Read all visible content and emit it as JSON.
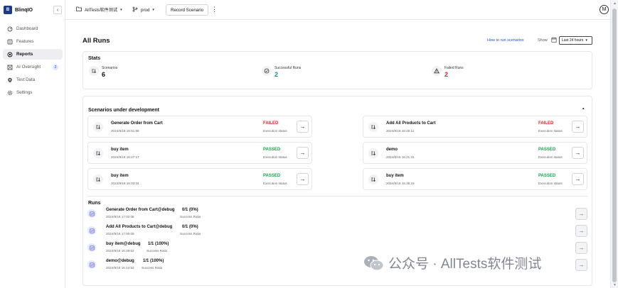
{
  "app": {
    "name": "BlinqIO",
    "logo_text": "B"
  },
  "sidebar": {
    "collapse_glyph": "‹",
    "items": [
      {
        "label": "Dashboard",
        "icon": "dashboard-icon",
        "active": false
      },
      {
        "label": "Features",
        "icon": "features-icon",
        "active": false
      },
      {
        "label": "Reports",
        "icon": "reports-icon",
        "active": true
      },
      {
        "label": "AI Oversight",
        "icon": "ai-oversight-icon",
        "active": false,
        "badge": "2"
      },
      {
        "label": "Test Data",
        "icon": "test-data-icon",
        "active": false
      },
      {
        "label": "Settings",
        "icon": "gear-icon",
        "active": false
      }
    ]
  },
  "topbar": {
    "project": "AllTests软件测试",
    "environment": "prod",
    "record_button": "Record Scenario",
    "more_glyph": "⋮",
    "avatar_initial": "M"
  },
  "page": {
    "title": "All Runs",
    "howto_link": "How to run scenarios",
    "show_label": "Show",
    "range_value": "Last 24 hours"
  },
  "stats": {
    "title": "Stats",
    "items": [
      {
        "label": "Scenarios",
        "value": "6",
        "color": "#111111"
      },
      {
        "label": "Successful Runs",
        "value": "2",
        "color": "#0d9488"
      },
      {
        "label": "Failed Runs",
        "value": "2",
        "color": "#dc2626"
      }
    ]
  },
  "scenarios": {
    "title": "Scenarios under development",
    "collapse_glyph": "▴",
    "items": [
      {
        "name": "Generate Order from Cart",
        "date": "2024/8/18 16:51:58",
        "status": "FAILED",
        "status_sub": "Execution status"
      },
      {
        "name": "Add All Products to Cart",
        "date": "2024/8/18 16:45:11",
        "status": "FAILED",
        "status_sub": "Execution status"
      },
      {
        "name": "buy item",
        "date": "2024/8/18 16:27:17",
        "status": "PASSED",
        "status_sub": "Execution status"
      },
      {
        "name": "demo",
        "date": "2024/8/18 16:21:31",
        "status": "PASSED",
        "status_sub": "Execution status"
      },
      {
        "name": "buy item",
        "date": "2024/8/18 16:03:34",
        "status": "PASSED",
        "status_sub": "Execution status"
      },
      {
        "name": "buy item",
        "date": "2024/8/18 15:35:15",
        "status": "PASSED",
        "status_sub": "Execution status"
      }
    ]
  },
  "runs": {
    "title": "Runs",
    "items": [
      {
        "name": "Generate Order from Cart@debug",
        "date": "2024/8/18 17:02:06",
        "ratio": "0/1 (0%)",
        "ratio_sub": "Success Ratio"
      },
      {
        "name": "Add All Products to Cart@debug",
        "date": "2024/8/18 17:00:09",
        "ratio": "0/1 (0%)",
        "ratio_sub": "Success Ratio"
      },
      {
        "name": "buy item@debug",
        "date": "2024/8/18 16:29:02",
        "ratio": "1/1 (100%)",
        "ratio_sub": "Success Ratio"
      },
      {
        "name": "demo@debug",
        "date": "2024/8/18 16:14:52",
        "ratio": "1/1 (100%)",
        "ratio_sub": "Success Ratio"
      }
    ]
  },
  "watermark": {
    "text": "公众号 · AllTests软件测试"
  },
  "arrow_glyph": "→"
}
